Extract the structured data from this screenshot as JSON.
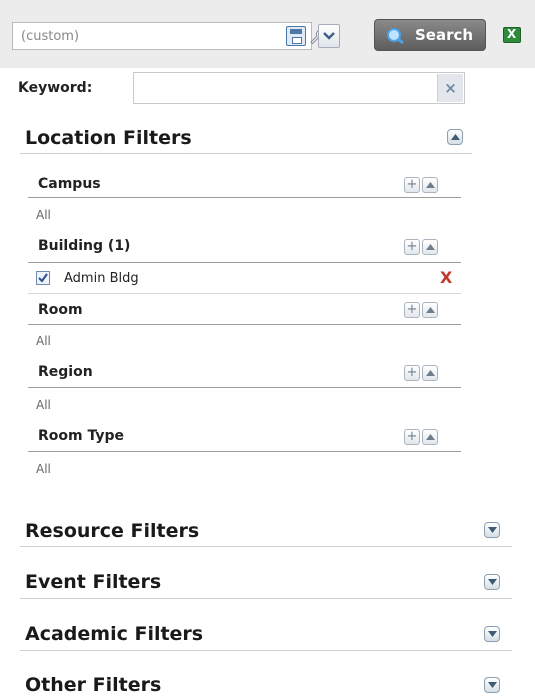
{
  "toolbar": {
    "preset_value": "(custom)",
    "search_label": "Search",
    "icons": [
      "save-icon",
      "wrench-icon",
      "chevron-down-icon",
      "search-icon",
      "excel-icon"
    ]
  },
  "keyword": {
    "label": "Keyword:",
    "value": "",
    "clear_label": "×"
  },
  "location_filters": {
    "title": "Location Filters",
    "groups": [
      {
        "title": "Campus",
        "value": "All"
      },
      {
        "title": "Building (1)",
        "selected": [
          {
            "label": "Admin Bldg",
            "checked": true
          }
        ]
      },
      {
        "title": "Room",
        "value": "All"
      },
      {
        "title": "Region",
        "value": "All"
      },
      {
        "title": "Room Type",
        "value": "All"
      }
    ],
    "remove_label": "X"
  },
  "collapsed_sections": [
    {
      "title": "Resource Filters"
    },
    {
      "title": "Event Filters"
    },
    {
      "title": "Academic Filters"
    },
    {
      "title": "Other Filters"
    }
  ],
  "colors": {
    "toolbar_bg": "#ececec",
    "search_button": "#6f6f6f",
    "remove_red": "#c0392b",
    "excel_green": "#2e8b3a"
  }
}
